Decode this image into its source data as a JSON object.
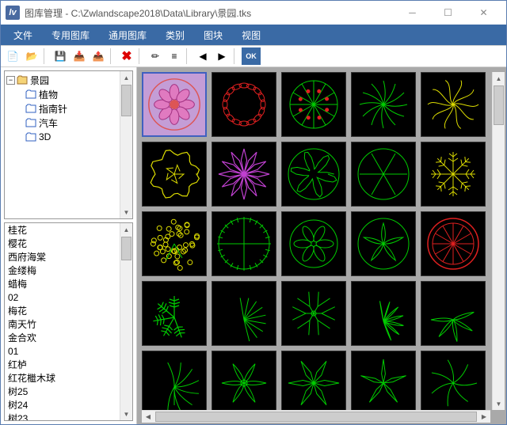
{
  "window": {
    "title": "图库管理 - C:\\Zwlandscape2018\\Data\\Library\\景园.tks"
  },
  "menu": {
    "items": [
      "文件",
      "专用图库",
      "通用图库",
      "类别",
      "图块",
      "视图"
    ]
  },
  "toolbar": {
    "buttons": [
      {
        "name": "new-icon",
        "glyph": "📄"
      },
      {
        "name": "open-icon",
        "glyph": "📂"
      },
      {
        "name": "sep"
      },
      {
        "name": "save-icon",
        "glyph": "💾"
      },
      {
        "name": "import-icon",
        "glyph": "📥"
      },
      {
        "name": "export-icon",
        "glyph": "📤"
      },
      {
        "name": "sep"
      },
      {
        "name": "delete-icon",
        "glyph": "✖"
      },
      {
        "name": "sep"
      },
      {
        "name": "edit-icon",
        "glyph": "✏"
      },
      {
        "name": "properties-icon",
        "glyph": "≡"
      },
      {
        "name": "sep"
      },
      {
        "name": "nav-left-icon",
        "glyph": "◀"
      },
      {
        "name": "nav-right-icon",
        "glyph": "▶"
      },
      {
        "name": "sep"
      },
      {
        "name": "ok-icon",
        "glyph": "OK"
      }
    ]
  },
  "tree": {
    "root": {
      "label": "景园",
      "expanded": true
    },
    "children": [
      {
        "label": "植物"
      },
      {
        "label": "指南针"
      },
      {
        "label": "汽车"
      },
      {
        "label": "3D"
      }
    ]
  },
  "list": {
    "items": [
      "桂花",
      "樱花",
      "西府海棠",
      "金缕梅",
      "蜡梅",
      "02",
      "梅花",
      "南天竹",
      "金合欢",
      "01",
      "红栌",
      "红花檵木球",
      "树25",
      "树24",
      "树23"
    ]
  },
  "thumbnails": {
    "selected_index": 0,
    "count": 25
  }
}
